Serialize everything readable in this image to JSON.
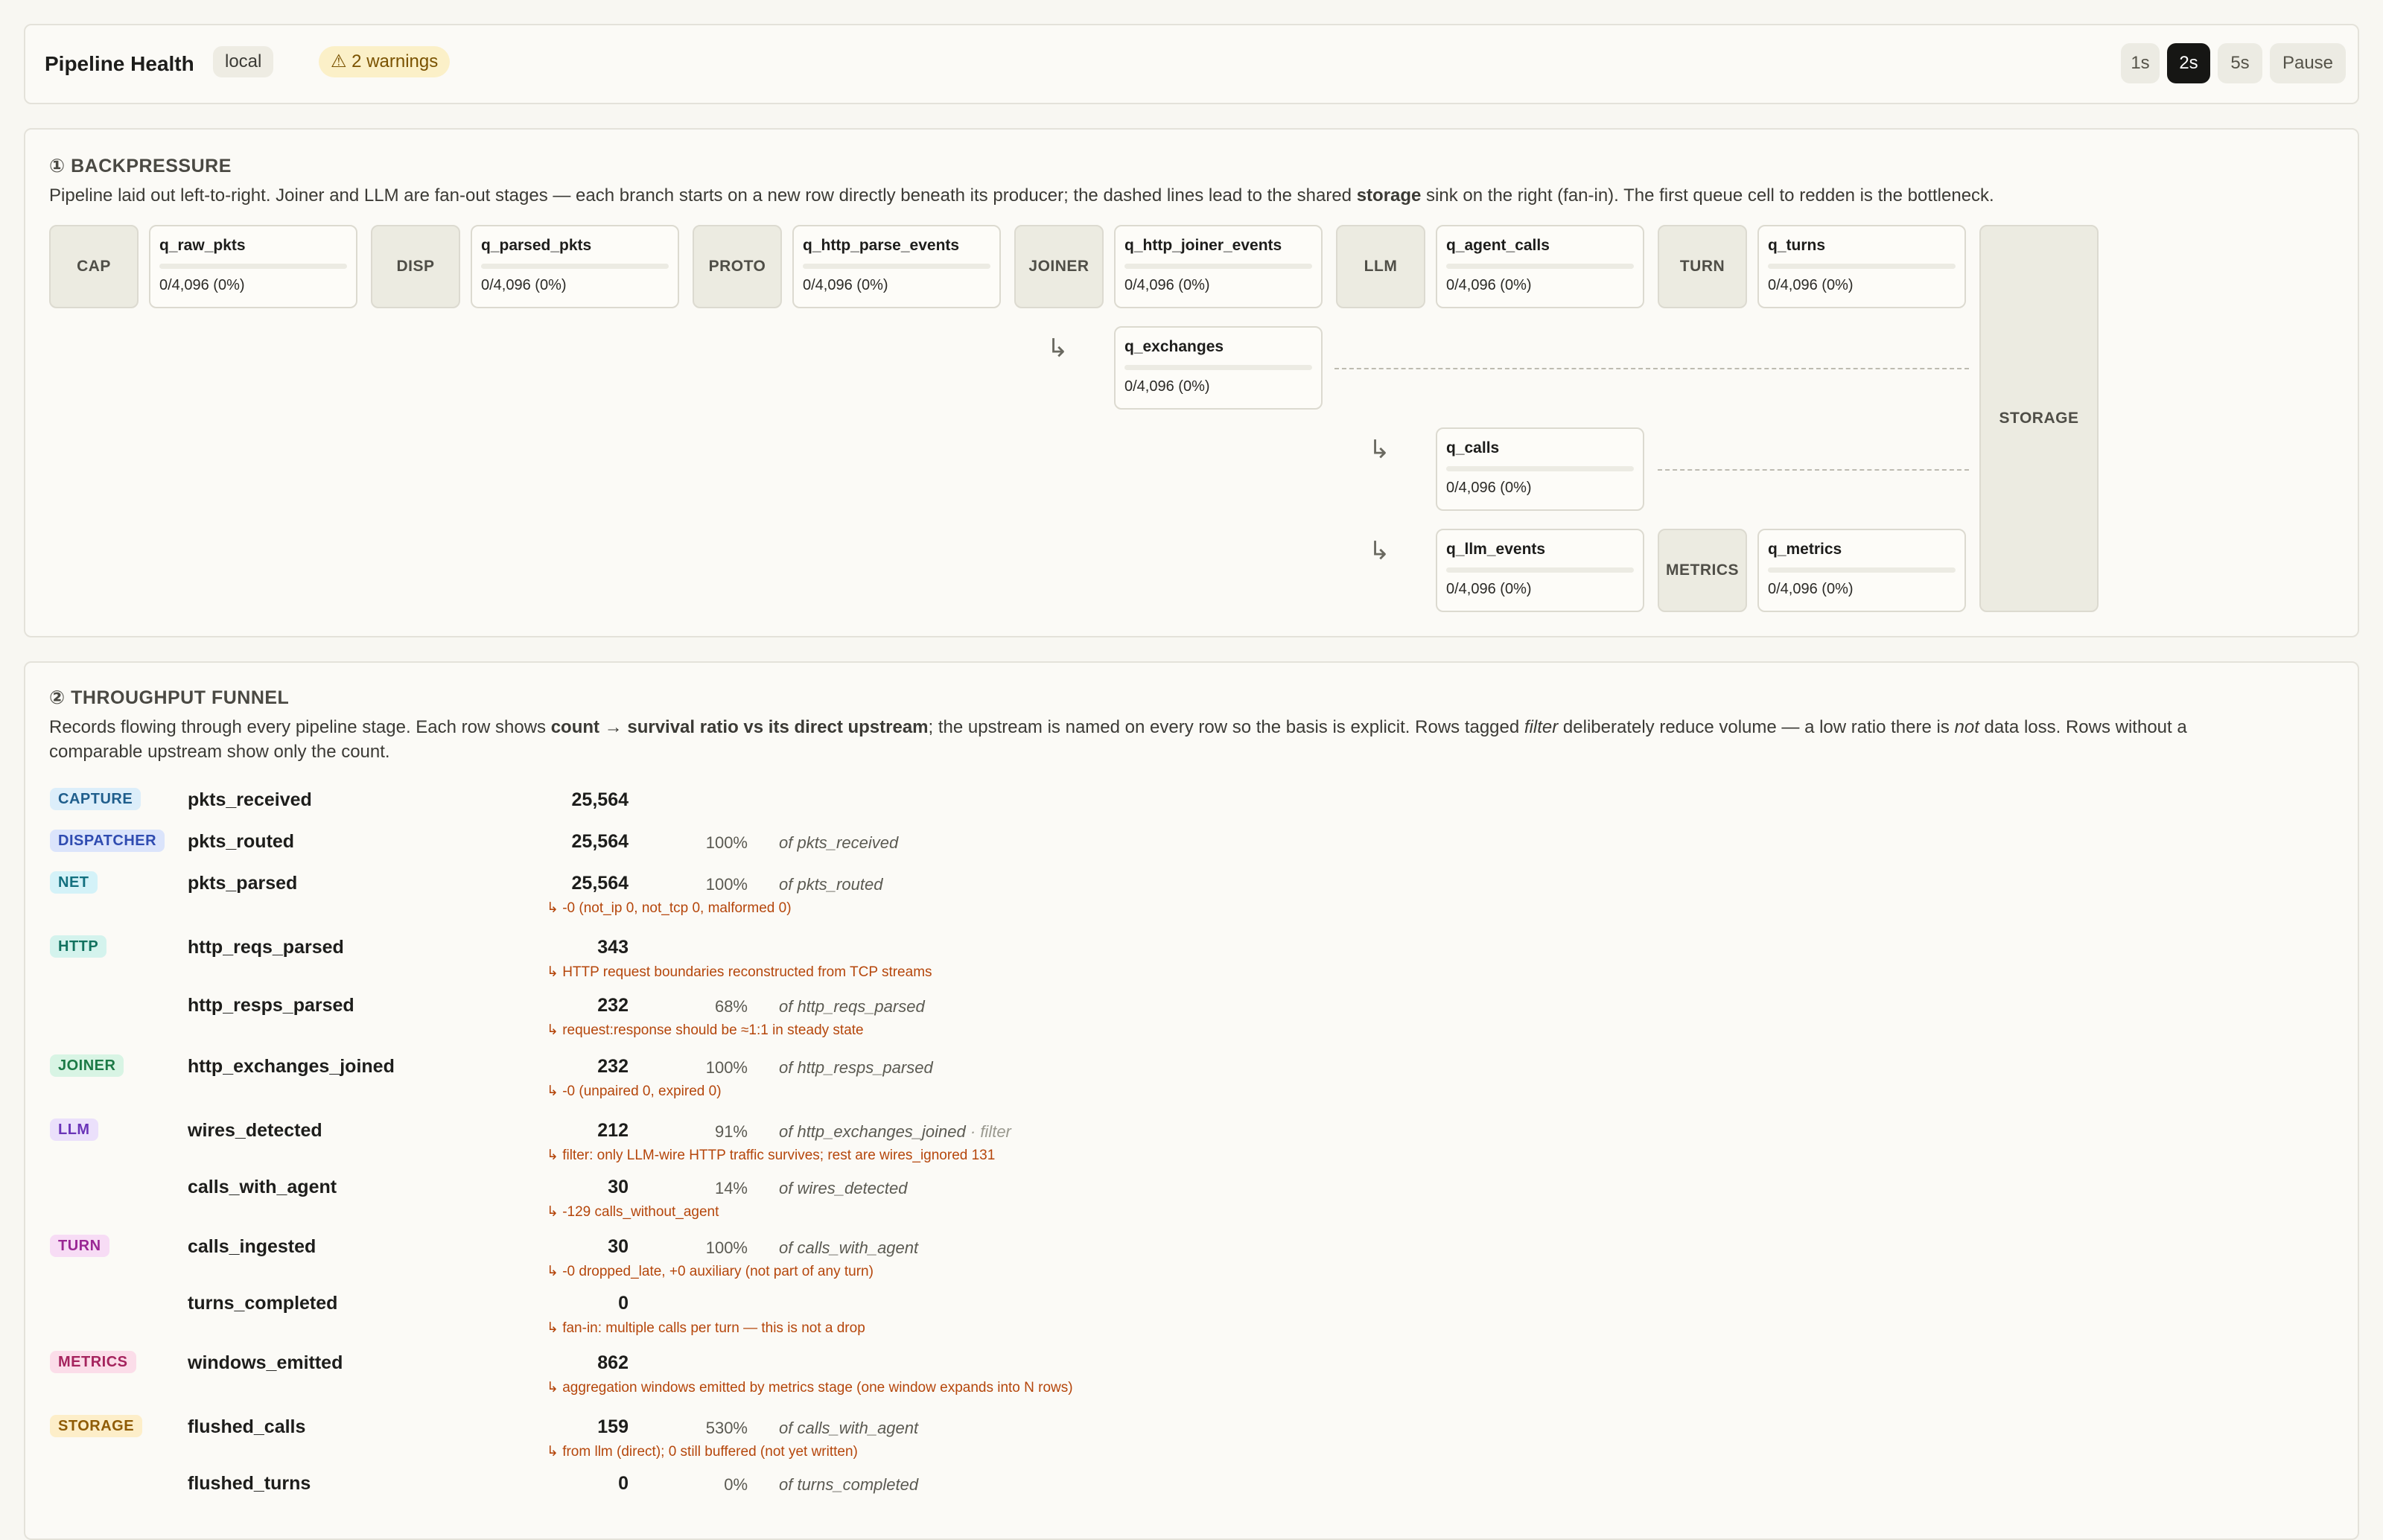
{
  "header": {
    "title": "Pipeline Health",
    "env": "local",
    "warnings": "⚠ 2 warnings",
    "rates": [
      "1s",
      "2s",
      "5s",
      "Pause"
    ],
    "active_rate": "2s"
  },
  "backpressure": {
    "title": "① BACKPRESSURE",
    "desc_before": "Pipeline laid out left-to-right. Joiner and LLM are fan-out stages — each branch starts on a new row directly beneath its producer; the dashed lines lead to the shared ",
    "desc_bold": "storage",
    "desc_after": " sink on the right (fan-in). The first queue cell to redden is the bottleneck.",
    "stages": {
      "cap": "CAP",
      "disp": "DISP",
      "proto": "PROTO",
      "joiner": "JOINER",
      "llm": "LLM",
      "turn": "TURN",
      "metrics": "METRICS",
      "storage": "STORAGE"
    },
    "branch_glyph": "↳",
    "queues": {
      "raw": {
        "name": "q_raw_pkts",
        "value": "0/4,096 (0%)",
        "fill": 0
      },
      "parsed": {
        "name": "q_parsed_pkts",
        "value": "0/4,096 (0%)",
        "fill": 0
      },
      "http": {
        "name": "q_http_parse_events",
        "value": "0/4,096 (0%)",
        "fill": 0
      },
      "joiner": {
        "name": "q_http_joiner_events",
        "value": "0/4,096 (0%)",
        "fill": 0
      },
      "agent": {
        "name": "q_agent_calls",
        "value": "0/4,096 (0%)",
        "fill": 0
      },
      "turns": {
        "name": "q_turns",
        "value": "0/4,096 (0%)",
        "fill": 0
      },
      "exchanges": {
        "name": "q_exchanges",
        "value": "0/4,096 (0%)",
        "fill": 0
      },
      "calls": {
        "name": "q_calls",
        "value": "0/4,096 (0%)",
        "fill": 0
      },
      "llm": {
        "name": "q_llm_events",
        "value": "0/4,096 (0%)",
        "fill": 0
      },
      "metrics": {
        "name": "q_metrics",
        "value": "0/4,096 (0%)",
        "fill": 0
      }
    }
  },
  "funnel": {
    "title": "② THROUGHPUT FUNNEL",
    "desc_1": "Records flowing through every pipeline stage. Each row shows ",
    "desc_bold": "count → survival ratio vs its direct upstream",
    "desc_2": "; the upstream is named on every row so the basis is explicit. Rows tagged ",
    "desc_italic1": "filter",
    "desc_3": " deliberately reduce volume — a low ratio there is ",
    "desc_italic2": "not",
    "desc_4": " data loss. Rows without a comparable upstream show only the count.",
    "rows": [
      {
        "tag": "CAPTURE",
        "metric": "pkts_received",
        "count": "25,564",
        "pct": "",
        "of": "",
        "filter": "",
        "note": ""
      },
      {
        "tag": "DISPATCHER",
        "metric": "pkts_routed",
        "count": "25,564",
        "pct": "100%",
        "of": "of pkts_received",
        "filter": "",
        "note": ""
      },
      {
        "tag": "NET",
        "metric": "pkts_parsed",
        "count": "25,564",
        "pct": "100%",
        "of": "of pkts_routed",
        "filter": "",
        "note": "↳ -0 (not_ip 0, not_tcp 0, malformed 0)"
      },
      {
        "tag": "HTTP",
        "metric": "http_reqs_parsed",
        "count": "343",
        "pct": "",
        "of": "",
        "filter": "",
        "note": "↳ HTTP request boundaries reconstructed from TCP streams"
      },
      {
        "tag": "",
        "metric": "http_resps_parsed",
        "count": "232",
        "pct": "68%",
        "of": "of http_reqs_parsed",
        "filter": "",
        "note": "↳ request:response should be ≈1:1 in steady state"
      },
      {
        "tag": "JOINER",
        "metric": "http_exchanges_joined",
        "count": "232",
        "pct": "100%",
        "of": "of http_resps_parsed",
        "filter": "",
        "note": "↳ -0 (unpaired 0, expired 0)"
      },
      {
        "tag": "LLM",
        "metric": "wires_detected",
        "count": "212",
        "pct": "91%",
        "of": "of http_exchanges_joined",
        "filter": " · filter",
        "note": "↳ filter: only LLM-wire HTTP traffic survives; rest are wires_ignored 131"
      },
      {
        "tag": "",
        "metric": "calls_with_agent",
        "count": "30",
        "pct": "14%",
        "of": "of wires_detected",
        "filter": "",
        "note": "↳ -129 calls_without_agent"
      },
      {
        "tag": "TURN",
        "metric": "calls_ingested",
        "count": "30",
        "pct": "100%",
        "of": "of calls_with_agent",
        "filter": "",
        "note": "↳ -0 dropped_late, +0 auxiliary (not part of any turn)"
      },
      {
        "tag": "",
        "metric": "turns_completed",
        "count": "0",
        "pct": "",
        "of": "",
        "filter": "",
        "note": "↳ fan-in: multiple calls per turn — this is not a drop"
      },
      {
        "tag": "METRICS",
        "metric": "windows_emitted",
        "count": "862",
        "pct": "",
        "of": "",
        "filter": "",
        "note": "↳ aggregation windows emitted by metrics stage (one window expands into N rows)"
      },
      {
        "tag": "STORAGE",
        "metric": "flushed_calls",
        "count": "159",
        "pct": "530%",
        "of": "of calls_with_agent",
        "filter": "",
        "note": "↳ from llm (direct); 0 still buffered (not yet written)"
      },
      {
        "tag": "",
        "metric": "flushed_turns",
        "count": "0",
        "pct": "0%",
        "of": "of turns_completed",
        "filter": "",
        "note": ""
      }
    ]
  },
  "colors": {
    "CAPTURE": {
      "bg": "#dceefa",
      "fg": "#1f5e8c"
    },
    "DISPATCHER": {
      "bg": "#dbe4fb",
      "fg": "#2f4bb0"
    },
    "NET": {
      "bg": "#d4f2f8",
      "fg": "#13707f"
    },
    "HTTP": {
      "bg": "#d4f3ed",
      "fg": "#12725f"
    },
    "JOINER": {
      "bg": "#d8f4e4",
      "fg": "#1c7a46"
    },
    "LLM": {
      "bg": "#ebe0fb",
      "fg": "#6a34b8"
    },
    "TURN": {
      "bg": "#f7dcf5",
      "fg": "#9a2794"
    },
    "METRICS": {
      "bg": "#fbdde9",
      "fg": "#a5245e"
    },
    "STORAGE": {
      "bg": "#fdeec9",
      "fg": "#8f5b05"
    },
    "warning_note": "#b5460b"
  }
}
